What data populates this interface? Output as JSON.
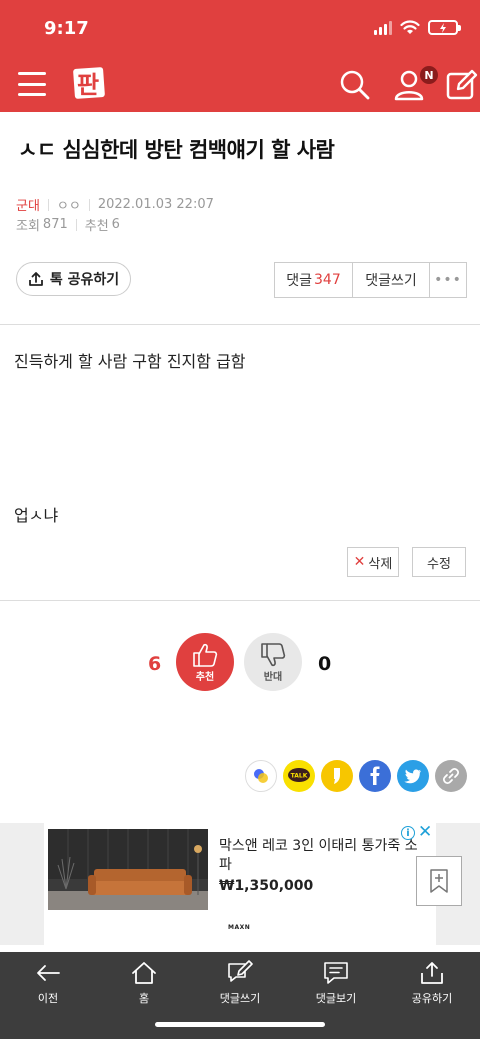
{
  "status": {
    "time": "9:17"
  },
  "header": {
    "logo_text": "판",
    "notification_badge": "N",
    "brand_color": "#e0403f"
  },
  "post": {
    "title": "ㅅㄷ 심심한데 방탄 컴백얘기 할 사람",
    "category": "군대",
    "author": "ㅇㅇ",
    "datetime": "2022.01.03 22:07",
    "views_label": "조회",
    "views": "871",
    "recommend_label": "추천",
    "recommend": "6",
    "body_lines": [
      "진득하게 할 사람 구함 진지함 급함",
      "업ㅅ냐"
    ]
  },
  "actions": {
    "share_label": "톡 공유하기",
    "comment_label": "댓글",
    "comment_count": "347",
    "write_comment_label": "댓글쓰기",
    "more_label": "•••",
    "delete_label": "삭제",
    "edit_label": "수정"
  },
  "votes": {
    "up_count": "6",
    "up_label": "추천",
    "down_count": "0",
    "down_label": "반대"
  },
  "social_icons": [
    "band-icon",
    "kakaotalk-icon",
    "kakaostory-icon",
    "facebook-icon",
    "twitter-icon",
    "link-icon"
  ],
  "ad": {
    "title": "막스앤 레코 3인 이태리 통가죽 소파",
    "price": "₩1,350,000",
    "brand": "MAXN"
  },
  "bottom_nav": [
    {
      "label": "이전",
      "icon": "back-arrow-icon"
    },
    {
      "label": "홈",
      "icon": "home-icon"
    },
    {
      "label": "댓글쓰기",
      "icon": "write-icon"
    },
    {
      "label": "댓글보기",
      "icon": "comments-icon"
    },
    {
      "label": "공유하기",
      "icon": "share-icon"
    }
  ]
}
